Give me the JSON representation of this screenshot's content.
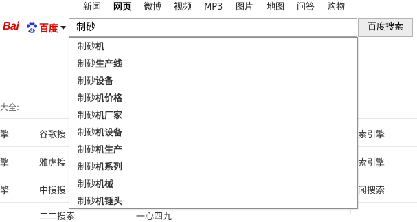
{
  "nav": {
    "items": [
      {
        "label": "新闻"
      },
      {
        "label": "网页"
      },
      {
        "label": "微博"
      },
      {
        "label": "视频"
      },
      {
        "label": "MP3"
      },
      {
        "label": "图片"
      },
      {
        "label": "地图"
      },
      {
        "label": "问答"
      },
      {
        "label": "购物"
      }
    ],
    "active": "网页"
  },
  "logo": {
    "text_latin": "Bai",
    "text_cn": "百度"
  },
  "search": {
    "value": "制砂",
    "button_label": "百度搜索"
  },
  "suggestions": [
    {
      "typed": "制砂",
      "rest": "机"
    },
    {
      "typed": "制砂",
      "rest": "生产线"
    },
    {
      "typed": "制砂",
      "rest": "设备"
    },
    {
      "typed": "制砂",
      "rest": "机价格"
    },
    {
      "typed": "制砂",
      "rest": "机厂家"
    },
    {
      "typed": "制砂",
      "rest": "机设备"
    },
    {
      "typed": "制砂",
      "rest": "机生产"
    },
    {
      "typed": "制砂",
      "rest": "机系列"
    },
    {
      "typed": "制砂",
      "rest": "机械"
    },
    {
      "typed": "制砂",
      "rest": "机锤头"
    }
  ],
  "background": {
    "section_label": "大全:",
    "rows": [
      {
        "left": "擎",
        "col2": "谷歌搜",
        "right": "索引擎"
      },
      {
        "left": "擎",
        "col2": "雅虎搜",
        "right": "索引擎"
      },
      {
        "left": "擎",
        "col2": "中搜搜",
        "right": "闻搜索"
      },
      {
        "left": "",
        "col2": "二二搜索",
        "col3": "一心四九",
        "right": ""
      }
    ]
  },
  "colors": {
    "brand_red": "#e10601",
    "border": "#a9a9a9",
    "button_bg": "#ececec"
  }
}
